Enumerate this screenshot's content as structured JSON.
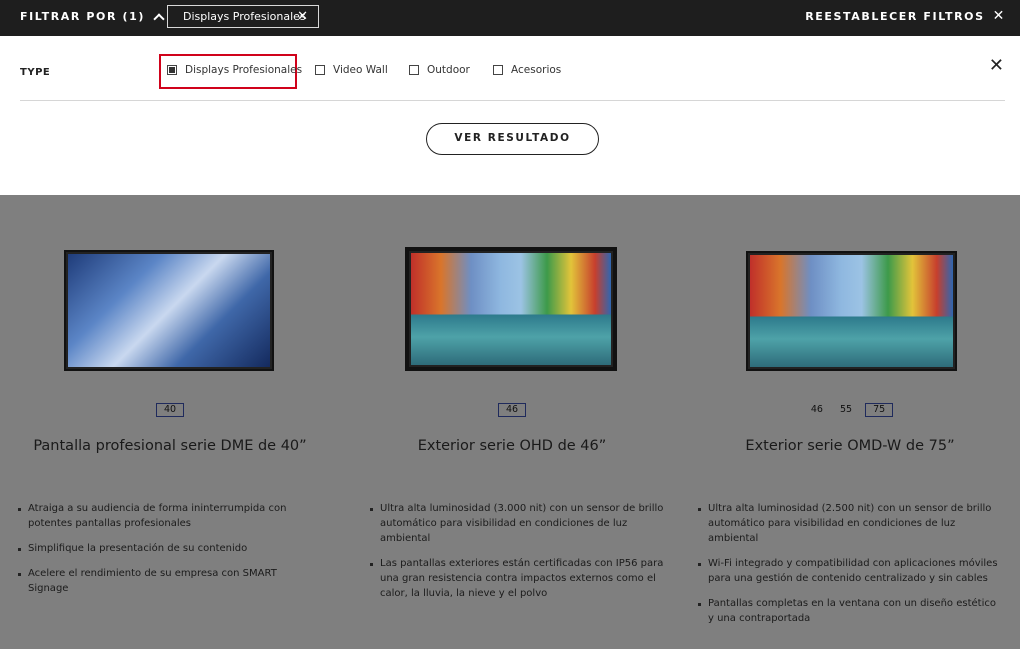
{
  "topbar": {
    "filter_label": "FILTRAR POR (1)",
    "active_chip": "Displays Profesionales",
    "reset_label": "REESTABLECER FILTROS"
  },
  "panel": {
    "type_label": "TYPE",
    "options": [
      {
        "label": "Displays Profesionales",
        "checked": true
      },
      {
        "label": "Video Wall",
        "checked": false
      },
      {
        "label": "Outdoor",
        "checked": false
      },
      {
        "label": "Acesorios",
        "checked": false
      }
    ],
    "see_results": "VER RESULTADO"
  },
  "products": [
    {
      "sizes": [
        "40"
      ],
      "selected_size": "40",
      "title": "Pantalla profesional serie DME de 40”",
      "features": [
        "Atraiga a su audiencia de forma ininterrumpida con potentes pantallas profesionales",
        "Simplifique la presentación de su contenido",
        "Acelere el rendimiento de su empresa con SMART Signage"
      ]
    },
    {
      "sizes": [
        "46"
      ],
      "selected_size": "46",
      "title": "Exterior serie OHD de 46”",
      "features": [
        "Ultra alta luminosidad (3.000 nit) con un sensor de brillo automático para visibilidad en condiciones de luz ambiental",
        "Las pantallas exteriores están certificadas con IP56 para una gran resistencia contra impactos externos como el calor, la lluvia, la nieve y el polvo"
      ]
    },
    {
      "sizes": [
        "46",
        "55",
        "75"
      ],
      "selected_size": "75",
      "title": "Exterior serie OMD-W de 75”",
      "features": [
        "Ultra alta luminosidad (2.500 nit) con un sensor de brillo automático para visibilidad en condiciones de luz ambiental",
        "Wi-Fi integrado y compatibilidad con aplicaciones móviles para una gestión de contenido centralizado y sin cables",
        "Pantallas completas en la ventana con un diseño estético y una contraportada"
      ]
    }
  ]
}
